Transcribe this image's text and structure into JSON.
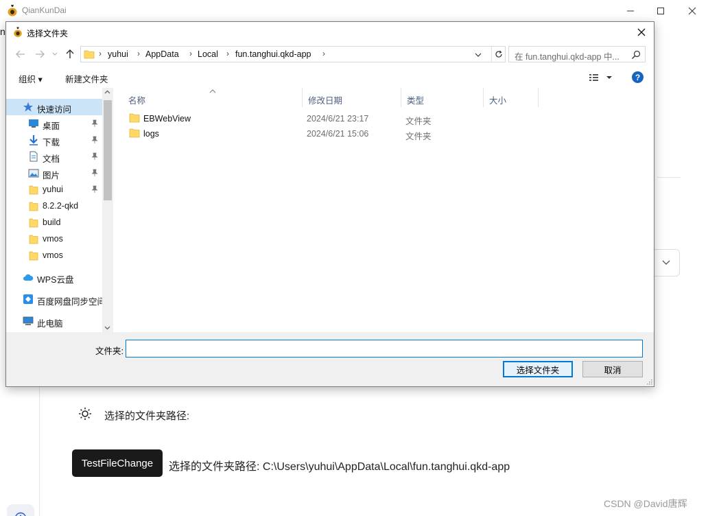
{
  "app": {
    "title": "QianKunDai",
    "strip_letter": "n",
    "path_label": "选择的文件夹路径:",
    "test_button": "TestFileChange",
    "path_result": "选择的文件夹路径: C:\\Users\\yuhui\\AppData\\Local\\fun.tanghui.qkd-app",
    "watermark": "CSDN @David唐辉",
    "window_controls": [
      "minimize-icon",
      "maximize-icon",
      "close-icon"
    ]
  },
  "dialog": {
    "title": "选择文件夹",
    "breadcrumbs": [
      "yuhui",
      "AppData",
      "Local",
      "fun.tanghui.qkd-app"
    ],
    "search_placeholder": "在 fun.tanghui.qkd-app 中...",
    "toolbar": {
      "organize": "组织 ▾",
      "new_folder": "新建文件夹"
    },
    "nav": [
      {
        "label": "快速访问",
        "icon": "star-icon"
      },
      {
        "label": "桌面",
        "icon": "desktop-icon",
        "pinned": true
      },
      {
        "label": "下载",
        "icon": "download-icon",
        "pinned": true
      },
      {
        "label": "文档",
        "icon": "document-icon",
        "pinned": true
      },
      {
        "label": "图片",
        "icon": "picture-icon",
        "pinned": true
      },
      {
        "label": "yuhui",
        "icon": "folder-icon",
        "pinned": true
      },
      {
        "label": "8.2.2-qkd",
        "icon": "folder-icon"
      },
      {
        "label": "build",
        "icon": "folder-icon"
      },
      {
        "label": "vmos",
        "icon": "folder-icon"
      },
      {
        "label": "vmos",
        "icon": "folder-icon"
      },
      {
        "label": "WPS云盘",
        "icon": "cloud-icon"
      },
      {
        "label": "百度网盘同步空间",
        "icon": "baidu-sync-icon"
      },
      {
        "label": "此电脑",
        "icon": "computer-icon"
      }
    ],
    "columns": [
      "名称",
      "修改日期",
      "类型",
      "大小"
    ],
    "files": [
      {
        "name": "EBWebView",
        "date": "2024/6/21 23:17",
        "type": "文件夹"
      },
      {
        "name": "logs",
        "date": "2024/6/21 15:06",
        "type": "文件夹"
      }
    ],
    "folder_label": "文件夹:",
    "folder_value": "",
    "select_button": "选择文件夹",
    "cancel_button": "取消",
    "colors": {
      "accent": "#0078d7",
      "folder": "#ffd866",
      "selected_bg": "#cce4f7"
    }
  }
}
